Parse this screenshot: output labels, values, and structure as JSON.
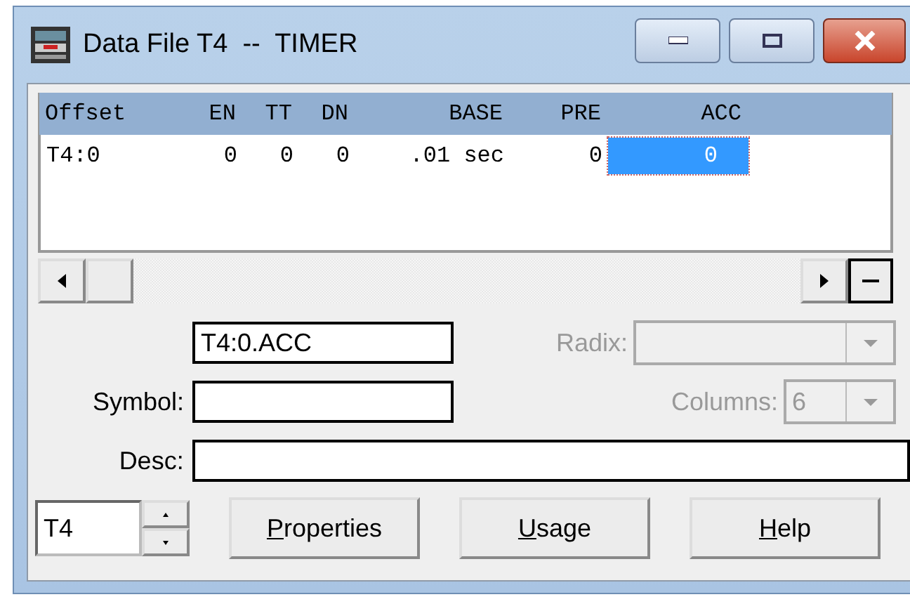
{
  "window": {
    "title": "Data File T4  --  TIMER"
  },
  "table": {
    "columns": [
      "Offset",
      "EN",
      "TT",
      "DN",
      "BASE",
      "PRE",
      "ACC"
    ],
    "rows": [
      {
        "cells": [
          {
            "text": "T4:0",
            "selected": false
          },
          {
            "text": "0",
            "selected": false
          },
          {
            "text": "0",
            "selected": false
          },
          {
            "text": "0",
            "selected": false
          },
          {
            "text": ".01 sec",
            "selected": false
          },
          {
            "text": "0",
            "selected": false
          },
          {
            "text": "0",
            "selected": true
          }
        ]
      }
    ]
  },
  "address": {
    "value": "T4:0.ACC"
  },
  "radix": {
    "label": "Radix:",
    "disabled": true
  },
  "symbol": {
    "label": "Symbol:"
  },
  "columns_field": {
    "label": "Columns:",
    "value": "6",
    "disabled": true
  },
  "desc": {
    "label": "Desc:"
  },
  "file_spinner": {
    "value": "T4"
  },
  "buttons": [
    {
      "accel": "P",
      "rest": "roperties"
    },
    {
      "accel": "U",
      "rest": "sage"
    },
    {
      "accel": "H",
      "rest": "elp"
    }
  ]
}
